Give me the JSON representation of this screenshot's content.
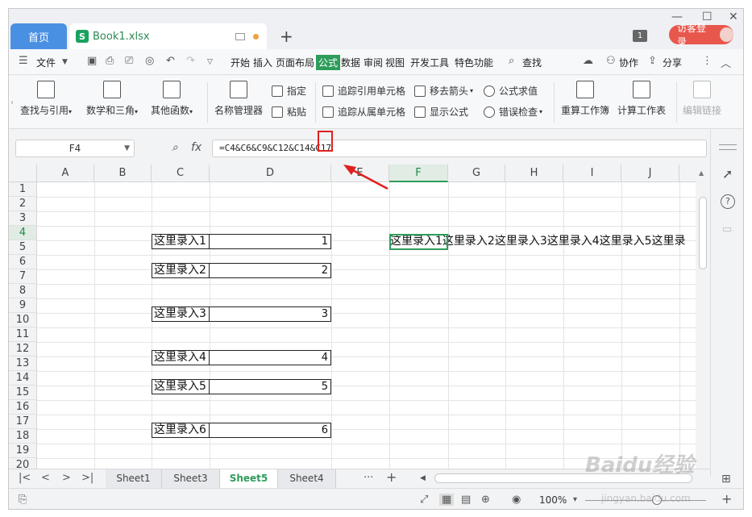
{
  "titlebar": {
    "home_tab": "首页",
    "doc_tab": "Book1.xlsx",
    "doc_logo": "S",
    "notif_count": "1",
    "login_label": "访客登录"
  },
  "menubar": {
    "file": "文件",
    "items": [
      "开始",
      "插入",
      "页面布局",
      "公式",
      "数据",
      "审阅",
      "视图",
      "开发工具",
      "特色功能"
    ],
    "active": "公式",
    "search": "查找",
    "collab": "协作",
    "share": "分享"
  },
  "ribbon": {
    "lookup": "查找与引用",
    "math": "数学和三角",
    "other": "其他函数",
    "name_mgr": "名称管理器",
    "assign": "指定",
    "paste": "粘贴",
    "trace_prec": "追踪引用单元格",
    "trace_dep": "追踪从属单元格",
    "remove_arrows": "移去箭头",
    "show_formula": "显示公式",
    "eval_formula": "公式求值",
    "error_check": "错误检查",
    "recalc_book": "重算工作簿",
    "calc_sheet": "计算工作表",
    "edit_links": "编辑链接"
  },
  "formula_bar": {
    "name_box": "F4",
    "fx": "fx",
    "formula": "=C4&C6&C9&C12&C14&C17"
  },
  "grid": {
    "columns": [
      "A",
      "B",
      "C",
      "D",
      "E",
      "F",
      "G",
      "H",
      "I",
      "J"
    ],
    "selected_column": "F",
    "rows": [
      "1",
      "2",
      "3",
      "4",
      "5",
      "6",
      "7",
      "8",
      "9",
      "10",
      "11",
      "12",
      "13",
      "14",
      "15",
      "16",
      "17",
      "18",
      "19",
      "20"
    ],
    "selected_row": "4",
    "cells": [
      {
        "row": "4",
        "c": "这里录入1",
        "d": "1"
      },
      {
        "row": "6",
        "c": "这里录入2",
        "d": "2"
      },
      {
        "row": "9",
        "c": "这里录入3",
        "d": "3"
      },
      {
        "row": "12",
        "c": "这里录入4",
        "d": "4"
      },
      {
        "row": "14",
        "c": "这里录入5",
        "d": "5"
      },
      {
        "row": "17",
        "c": "这里录入6",
        "d": "6"
      }
    ],
    "f4_value": "这里录入1这里录入2这里录入3这里录入4这里录入5这里录"
  },
  "sheets": {
    "tabs": [
      "Sheet1",
      "Sheet3",
      "Sheet5",
      "Sheet4"
    ],
    "active": "Sheet5",
    "more": "···"
  },
  "statusbar": {
    "zoom": "100%"
  },
  "watermark": {
    "brand": "Baidu经验",
    "url": "jingyan.baidu.com"
  },
  "colors": {
    "accent_green": "#2e9c5a",
    "home_tab_blue": "#4a90e2",
    "login_red": "#e8574c",
    "annotation_red": "#e02020"
  }
}
